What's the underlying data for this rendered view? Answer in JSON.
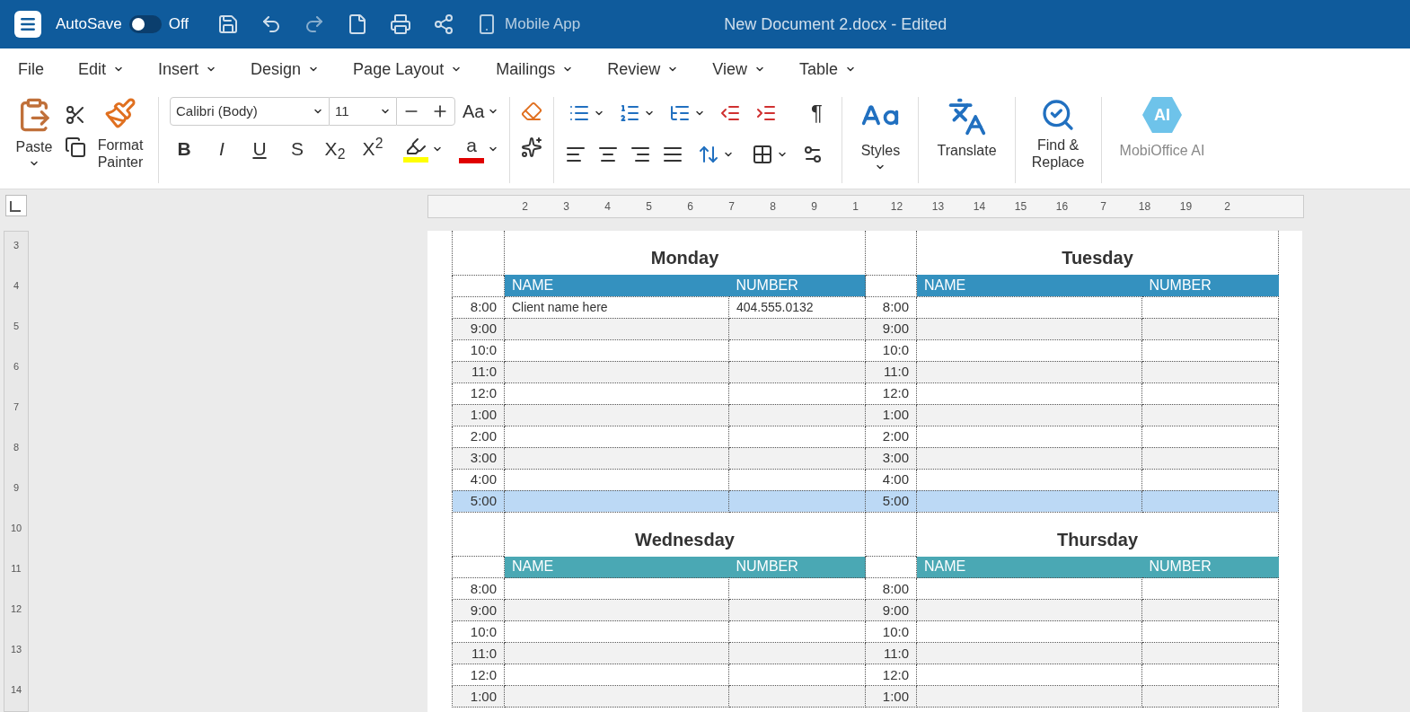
{
  "titlebar": {
    "autosave_label": "AutoSave",
    "autosave_on": false,
    "autosave_state": "Off",
    "mobile_app": "Mobile App",
    "title": "New Document 2.docx - Edited"
  },
  "menu": [
    {
      "label": "File",
      "dropdown": false
    },
    {
      "label": "Edit",
      "dropdown": true
    },
    {
      "label": "Insert",
      "dropdown": true
    },
    {
      "label": "Design",
      "dropdown": true
    },
    {
      "label": "Page Layout",
      "dropdown": true
    },
    {
      "label": "Mailings",
      "dropdown": true
    },
    {
      "label": "Review",
      "dropdown": true
    },
    {
      "label": "View",
      "dropdown": true
    },
    {
      "label": "Table",
      "dropdown": true
    }
  ],
  "ribbon": {
    "paste": "Paste",
    "format_painter": "Format Painter",
    "font": "Calibri (Body)",
    "size": "11",
    "case_button": "Aa",
    "format_buttons": [
      "B",
      "I",
      "U",
      "S",
      "X$_{2}$",
      "X$^{2}$"
    ],
    "font_color_letter": "a",
    "pilcrow": "¶",
    "styles": "Styles",
    "translate": "Translate",
    "find_replace": "Find & Replace",
    "ai": "MobiOffice AI",
    "ai_badge": "AI"
  },
  "h_ruler": [
    "2",
    "3",
    "4",
    "5",
    "6",
    "7",
    "8",
    "9",
    "1",
    "12",
    "13",
    "14",
    "15",
    "16",
    "7",
    "18",
    "19",
    "2"
  ],
  "v_ruler": [
    "3",
    "4",
    "5",
    "6",
    "7",
    "8",
    "9",
    "10",
    "11",
    "12",
    "13",
    "14"
  ],
  "blocks": [
    {
      "days": [
        {
          "title": "Monday",
          "color": "#3491bf",
          "columns": [
            "NAME",
            "NUMBER"
          ]
        },
        {
          "title": "Tuesday",
          "color": "#3491bf",
          "columns": [
            "NAME",
            "NUMBER"
          ]
        }
      ],
      "rows": [
        {
          "selected": false,
          "cells": [
            {
              "time": "8:00",
              "name": "Client name here",
              "number": "404.555.0132"
            },
            {
              "time": "8:00"
            }
          ]
        },
        {
          "selected": false,
          "cells": [
            {
              "time": "9:00"
            },
            {
              "time": "9:00"
            }
          ]
        },
        {
          "selected": false,
          "cells": [
            {
              "time": "10:0"
            },
            {
              "time": "10:0"
            }
          ]
        },
        {
          "selected": false,
          "cells": [
            {
              "time": "11:0"
            },
            {
              "time": "11:0"
            }
          ]
        },
        {
          "selected": false,
          "cells": [
            {
              "time": "12:0"
            },
            {
              "time": "12:0"
            }
          ]
        },
        {
          "selected": false,
          "cells": [
            {
              "time": "1:00"
            },
            {
              "time": "1:00"
            }
          ]
        },
        {
          "selected": false,
          "cells": [
            {
              "time": "2:00"
            },
            {
              "time": "2:00"
            }
          ]
        },
        {
          "selected": false,
          "cells": [
            {
              "time": "3:00"
            },
            {
              "time": "3:00"
            }
          ]
        },
        {
          "selected": false,
          "cells": [
            {
              "time": "4:00"
            },
            {
              "time": "4:00"
            }
          ]
        },
        {
          "selected": true,
          "cells": [
            {
              "time": "5:00"
            },
            {
              "time": "5:00"
            }
          ]
        }
      ]
    },
    {
      "days": [
        {
          "title": "Wednesday",
          "color": "#4aa8b4",
          "columns": [
            "NAME",
            "NUMBER"
          ]
        },
        {
          "title": "Thursday",
          "color": "#4aa8b4",
          "columns": [
            "NAME",
            "NUMBER"
          ]
        }
      ],
      "rows": [
        {
          "selected": false,
          "cells": [
            {
              "time": "8:00"
            },
            {
              "time": "8:00"
            }
          ]
        },
        {
          "selected": false,
          "cells": [
            {
              "time": "9:00"
            },
            {
              "time": "9:00"
            }
          ]
        },
        {
          "selected": false,
          "cells": [
            {
              "time": "10:0"
            },
            {
              "time": "10:0"
            }
          ]
        },
        {
          "selected": false,
          "cells": [
            {
              "time": "11:0"
            },
            {
              "time": "11:0"
            }
          ]
        },
        {
          "selected": false,
          "cells": [
            {
              "time": "12:0"
            },
            {
              "time": "12:0"
            }
          ]
        },
        {
          "selected": false,
          "cells": [
            {
              "time": "1:00"
            },
            {
              "time": "1:00"
            }
          ]
        }
      ]
    }
  ]
}
